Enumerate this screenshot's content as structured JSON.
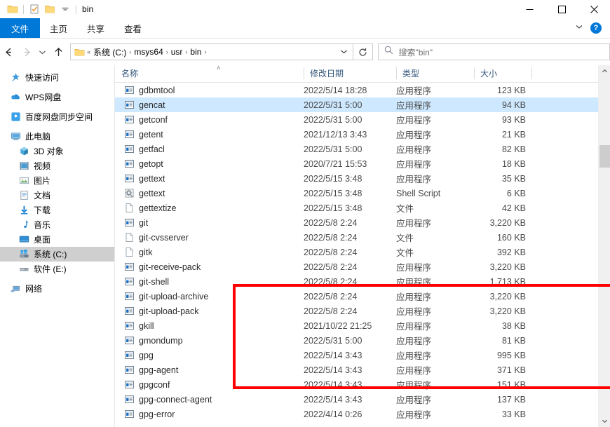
{
  "window": {
    "title": "bin",
    "quick_access_icons": [
      "folder-icon",
      "properties-icon",
      "new-folder-icon",
      "customize-dropdown-icon"
    ],
    "controls": {
      "minimize": "—",
      "maximize": "☐",
      "close": "✕"
    }
  },
  "ribbon": {
    "tabs": [
      {
        "label": "文件",
        "active": true
      },
      {
        "label": "主页",
        "active": false
      },
      {
        "label": "共享",
        "active": false
      },
      {
        "label": "查看",
        "active": false
      }
    ],
    "expand_icon": "chevron-down-icon",
    "help_label": "?"
  },
  "navbar": {
    "back_icon": "arrow-left-icon",
    "forward_icon": "arrow-right-icon",
    "recent_icon": "chevron-down-icon",
    "up_icon": "arrow-up-icon",
    "breadcrumb_prefix": "«",
    "breadcrumbs": [
      "系统 (C:)",
      "msys64",
      "usr",
      "bin"
    ],
    "breadcrumb_separator": "›",
    "dropdown_icon": "chevron-down-icon",
    "refresh_icon": "refresh-icon"
  },
  "search": {
    "placeholder": "搜索\"bin\"",
    "icon": "search-icon"
  },
  "sidebar": {
    "items": [
      {
        "label": "快速访问",
        "icon": "star-pin-icon",
        "indent": false,
        "selected": false,
        "spacer_after": true
      },
      {
        "label": "WPS网盘",
        "icon": "cloud-icon",
        "indent": false,
        "selected": false,
        "spacer_after": true
      },
      {
        "label": "百度网盘同步空间",
        "icon": "baidu-cloud-icon",
        "indent": false,
        "selected": false,
        "spacer_after": true
      },
      {
        "label": "此电脑",
        "icon": "computer-icon",
        "indent": false,
        "selected": false,
        "spacer_after": false
      },
      {
        "label": "3D 对象",
        "icon": "cube-icon",
        "indent": true,
        "selected": false,
        "spacer_after": false
      },
      {
        "label": "视频",
        "icon": "video-icon",
        "indent": true,
        "selected": false,
        "spacer_after": false
      },
      {
        "label": "图片",
        "icon": "pictures-icon",
        "indent": true,
        "selected": false,
        "spacer_after": false
      },
      {
        "label": "文档",
        "icon": "documents-icon",
        "indent": true,
        "selected": false,
        "spacer_after": false
      },
      {
        "label": "下载",
        "icon": "download-icon",
        "indent": true,
        "selected": false,
        "spacer_after": false
      },
      {
        "label": "音乐",
        "icon": "music-icon",
        "indent": true,
        "selected": false,
        "spacer_after": false
      },
      {
        "label": "桌面",
        "icon": "desktop-icon",
        "indent": true,
        "selected": false,
        "spacer_after": false
      },
      {
        "label": "系统 (C:)",
        "icon": "windows-drive-icon",
        "indent": true,
        "selected": true,
        "spacer_after": false
      },
      {
        "label": "软件 (E:)",
        "icon": "drive-icon",
        "indent": true,
        "selected": false,
        "spacer_after": true
      },
      {
        "label": "网络",
        "icon": "network-icon",
        "indent": false,
        "selected": false,
        "spacer_after": false
      }
    ]
  },
  "filelist": {
    "columns": [
      {
        "key": "name",
        "label": "名称"
      },
      {
        "key": "date",
        "label": "修改日期"
      },
      {
        "key": "type",
        "label": "类型"
      },
      {
        "key": "size",
        "label": "大小"
      }
    ],
    "sort_indicator": "˄",
    "rows": [
      {
        "name": "gdbmtool",
        "date": "2022/5/14 18:28",
        "type": "应用程序",
        "size": "123 KB",
        "icon": "exe-icon",
        "selected": false
      },
      {
        "name": "gencat",
        "date": "2022/5/31 5:00",
        "type": "应用程序",
        "size": "94 KB",
        "icon": "exe-icon",
        "selected": true
      },
      {
        "name": "getconf",
        "date": "2022/5/31 5:00",
        "type": "应用程序",
        "size": "93 KB",
        "icon": "exe-icon",
        "selected": false
      },
      {
        "name": "getent",
        "date": "2021/12/13 3:43",
        "type": "应用程序",
        "size": "21 KB",
        "icon": "exe-icon",
        "selected": false
      },
      {
        "name": "getfacl",
        "date": "2022/5/31 5:00",
        "type": "应用程序",
        "size": "82 KB",
        "icon": "exe-icon",
        "selected": false
      },
      {
        "name": "getopt",
        "date": "2020/7/21 15:53",
        "type": "应用程序",
        "size": "18 KB",
        "icon": "exe-icon",
        "selected": false
      },
      {
        "name": "gettext",
        "date": "2022/5/15 3:48",
        "type": "应用程序",
        "size": "35 KB",
        "icon": "exe-icon",
        "selected": false
      },
      {
        "name": "gettext",
        "date": "2022/5/15 3:48",
        "type": "Shell Script",
        "size": "6 KB",
        "icon": "shell-script-icon",
        "selected": false
      },
      {
        "name": "gettextize",
        "date": "2022/5/15 3:48",
        "type": "文件",
        "size": "42 KB",
        "icon": "file-icon",
        "selected": false
      },
      {
        "name": "git",
        "date": "2022/5/8 2:24",
        "type": "应用程序",
        "size": "3,220 KB",
        "icon": "exe-icon",
        "selected": false
      },
      {
        "name": "git-cvsserver",
        "date": "2022/5/8 2:24",
        "type": "文件",
        "size": "160 KB",
        "icon": "file-icon",
        "selected": false
      },
      {
        "name": "gitk",
        "date": "2022/5/8 2:24",
        "type": "文件",
        "size": "392 KB",
        "icon": "file-icon",
        "selected": false
      },
      {
        "name": "git-receive-pack",
        "date": "2022/5/8 2:24",
        "type": "应用程序",
        "size": "3,220 KB",
        "icon": "exe-icon",
        "selected": false
      },
      {
        "name": "git-shell",
        "date": "2022/5/8 2:24",
        "type": "应用程序",
        "size": "1,713 KB",
        "icon": "exe-icon",
        "selected": false
      },
      {
        "name": "git-upload-archive",
        "date": "2022/5/8 2:24",
        "type": "应用程序",
        "size": "3,220 KB",
        "icon": "exe-icon",
        "selected": false
      },
      {
        "name": "git-upload-pack",
        "date": "2022/5/8 2:24",
        "type": "应用程序",
        "size": "3,220 KB",
        "icon": "exe-icon",
        "selected": false
      },
      {
        "name": "gkill",
        "date": "2021/10/22 21:25",
        "type": "应用程序",
        "size": "38 KB",
        "icon": "exe-icon",
        "selected": false
      },
      {
        "name": "gmondump",
        "date": "2022/5/31 5:00",
        "type": "应用程序",
        "size": "81 KB",
        "icon": "exe-icon",
        "selected": false
      },
      {
        "name": "gpg",
        "date": "2022/5/14 3:43",
        "type": "应用程序",
        "size": "995 KB",
        "icon": "exe-icon",
        "selected": false
      },
      {
        "name": "gpg-agent",
        "date": "2022/5/14 3:43",
        "type": "应用程序",
        "size": "371 KB",
        "icon": "exe-icon",
        "selected": false
      },
      {
        "name": "gpgconf",
        "date": "2022/5/14 3:43",
        "type": "应用程序",
        "size": "151 KB",
        "icon": "exe-icon",
        "selected": false
      },
      {
        "name": "gpg-connect-agent",
        "date": "2022/5/14 3:43",
        "type": "应用程序",
        "size": "137 KB",
        "icon": "exe-icon",
        "selected": false
      },
      {
        "name": "gpg-error",
        "date": "2022/4/14 0:26",
        "type": "应用程序",
        "size": "33 KB",
        "icon": "exe-icon",
        "selected": false
      }
    ]
  },
  "annotation": {
    "color": "#ff0000",
    "highlighted_rows": [
      "git",
      "git-cvsserver",
      "gitk",
      "git-receive-pack",
      "git-shell",
      "git-upload-archive",
      "git-upload-pack"
    ]
  },
  "scrollbar": {
    "up_icon": "chevron-up-icon",
    "down_icon": "chevron-down-icon"
  }
}
